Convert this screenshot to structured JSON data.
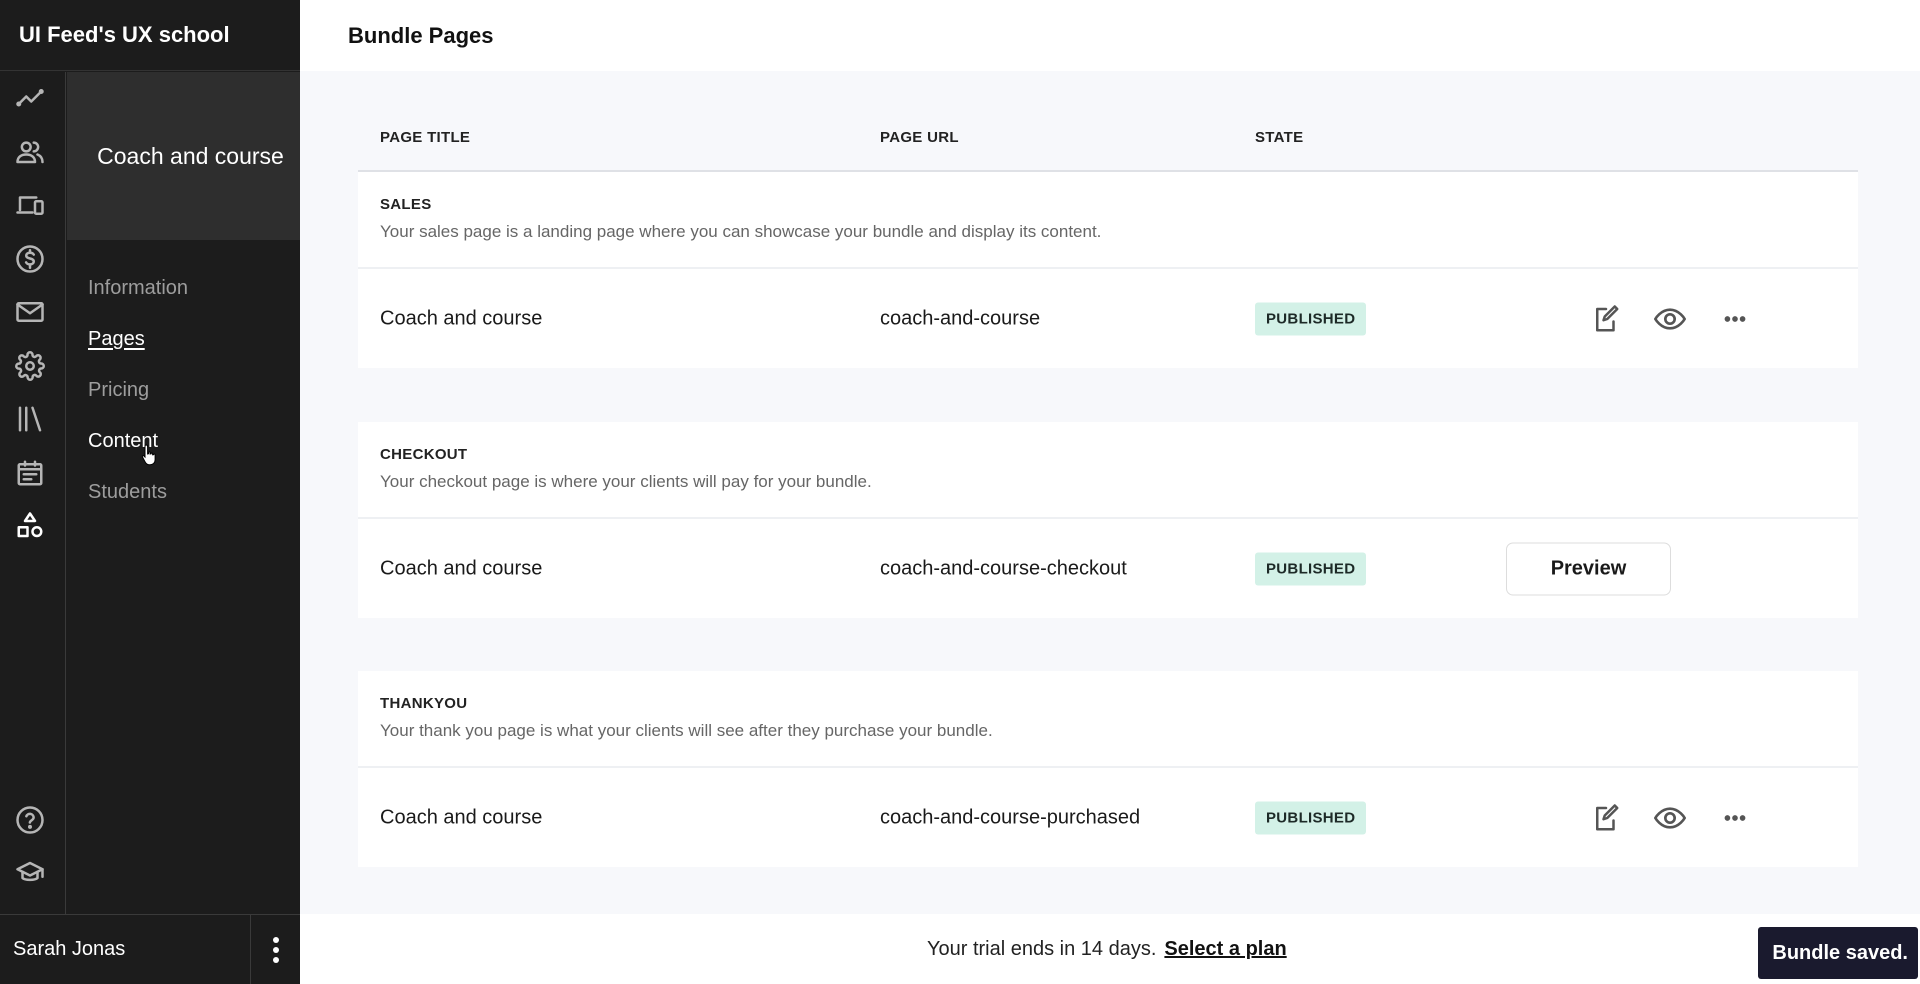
{
  "app": {
    "title": "UI Feed's UX school"
  },
  "rail": {
    "items": [
      {
        "icon": "analytics-icon",
        "label": "Analytics"
      },
      {
        "icon": "users-icon",
        "label": "Users"
      },
      {
        "icon": "devices-icon",
        "label": "Products"
      },
      {
        "icon": "dollar-icon",
        "label": "Sales"
      },
      {
        "icon": "mail-icon",
        "label": "Email"
      },
      {
        "icon": "gear-icon",
        "label": "Settings"
      },
      {
        "icon": "library-icon",
        "label": "Library"
      },
      {
        "icon": "calendar-icon",
        "label": "Calendar"
      },
      {
        "icon": "shapes-icon",
        "label": "Apps"
      }
    ],
    "bottom": [
      {
        "icon": "help-icon",
        "label": "Help"
      },
      {
        "icon": "graduation-cap-icon",
        "label": "Academy"
      }
    ]
  },
  "subnav": {
    "title": "Coach and course",
    "items": [
      {
        "label": "Information",
        "state": "default"
      },
      {
        "label": "Pages",
        "state": "active"
      },
      {
        "label": "Pricing",
        "state": "default"
      },
      {
        "label": "Content",
        "state": "hover"
      },
      {
        "label": "Students",
        "state": "default"
      }
    ]
  },
  "user": {
    "name": "Sarah Jonas"
  },
  "page": {
    "title": "Bundle Pages"
  },
  "table": {
    "columns": [
      "PAGE TITLE",
      "PAGE URL",
      "STATE"
    ],
    "sections": [
      {
        "title": "SALES",
        "description": "Your sales page is a landing page where you can showcase your bundle and display its content.",
        "row": {
          "page_title": "Coach and course",
          "page_url": "coach-and-course",
          "state": "PUBLISHED",
          "actions": [
            "edit",
            "view",
            "more"
          ]
        }
      },
      {
        "title": "CHECKOUT",
        "description": "Your checkout page is where your clients will pay for your bundle.",
        "row": {
          "page_title": "Coach and course",
          "page_url": "coach-and-course-checkout",
          "state": "PUBLISHED",
          "actions": [
            "preview"
          ],
          "preview_label": "Preview"
        }
      },
      {
        "title": "THANKYOU",
        "description": "Your thank you page is what your clients will see after they purchase your bundle.",
        "row": {
          "page_title": "Coach and course",
          "page_url": "coach-and-course-purchased",
          "state": "PUBLISHED",
          "actions": [
            "edit",
            "view",
            "more"
          ]
        }
      }
    ]
  },
  "footer": {
    "trial_text": "Your trial ends in 14 days.",
    "plan_link": "Select a plan",
    "toast": "Bundle saved."
  },
  "colors": {
    "sidebar_bg": "#1c1c1c",
    "subnav_head_bg": "#2e2e2e",
    "main_bg": "#f7f8fb",
    "badge_bg": "#d3f1e7",
    "toast_bg": "#1a1a2e"
  }
}
